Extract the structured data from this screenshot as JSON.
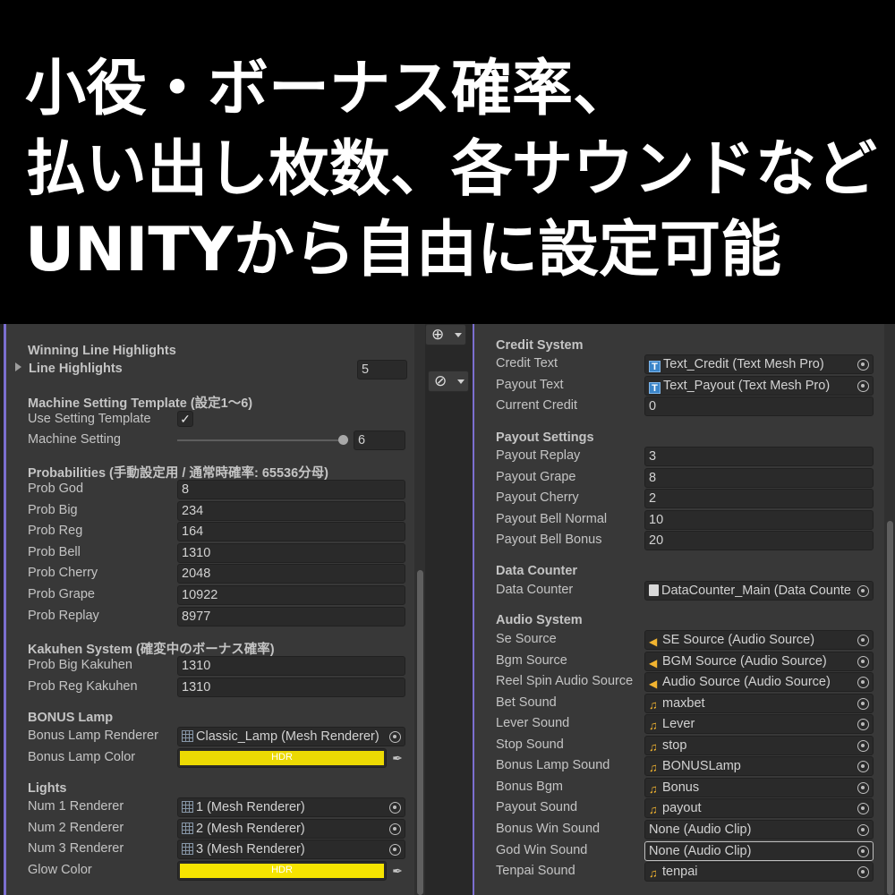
{
  "banner": {
    "line1": "小役・ボーナス確率、",
    "line2": "払い出し枚数、各サウンドなど",
    "line3": "UNITYから自由に設定可能"
  },
  "colors": {
    "lamp_color": "#ecda03",
    "glow_color": "#f6e400",
    "accent": "#7b6fd0"
  },
  "left": {
    "winning_header": "Winning Line Highlights",
    "line_highlights": {
      "label": "Line Highlights",
      "value": "5"
    },
    "machine_header": "Machine Setting Template (設定1～6)",
    "use_setting_template": {
      "label": "Use Setting Template",
      "checked": "✓"
    },
    "machine_setting": {
      "label": "Machine Setting",
      "value": "6"
    },
    "prob_header": "Probabilities (手動設定用 / 通常時確率: 65536分母)",
    "probs": [
      {
        "label": "Prob God",
        "value": "8"
      },
      {
        "label": "Prob Big",
        "value": "234"
      },
      {
        "label": "Prob Reg",
        "value": "164"
      },
      {
        "label": "Prob Bell",
        "value": "1310"
      },
      {
        "label": "Prob Cherry",
        "value": "2048"
      },
      {
        "label": "Prob Grape",
        "value": "10922"
      },
      {
        "label": "Prob Replay",
        "value": "8977"
      }
    ],
    "kakuhen_header": "Kakuhen System (確変中のボーナス確率)",
    "kakuhen": [
      {
        "label": "Prob Big Kakuhen",
        "value": "1310"
      },
      {
        "label": "Prob Reg Kakuhen",
        "value": "1310"
      }
    ],
    "bonus_header": "BONUS Lamp",
    "bonus_lamp_renderer": {
      "label": "Bonus Lamp Renderer",
      "value": "Classic_Lamp (Mesh Renderer)",
      "icon": "mesh-icon"
    },
    "bonus_lamp_color": {
      "label": "Bonus Lamp Color",
      "hdr": "HDR"
    },
    "lights_header": "Lights",
    "lights": [
      {
        "label": "Num 1 Renderer",
        "value": "1 (Mesh Renderer)"
      },
      {
        "label": "Num 2 Renderer",
        "value": "2 (Mesh Renderer)"
      },
      {
        "label": "Num 3 Renderer",
        "value": "3 (Mesh Renderer)"
      }
    ],
    "glow_color": {
      "label": "Glow Color",
      "hdr": "HDR"
    }
  },
  "right": {
    "credit_header": "Credit System",
    "credit_text": {
      "label": "Credit Text",
      "value": "Text_Credit (Text Mesh Pro)"
    },
    "payout_text": {
      "label": "Payout Text",
      "value": "Text_Payout (Text Mesh Pro)"
    },
    "current_credit": {
      "label": "Current Credit",
      "value": "0"
    },
    "payout_header": "Payout Settings",
    "payouts": [
      {
        "label": "Payout Replay",
        "value": "3"
      },
      {
        "label": "Payout Grape",
        "value": "8"
      },
      {
        "label": "Payout Cherry",
        "value": "2"
      },
      {
        "label": "Payout Bell Normal",
        "value": "10"
      },
      {
        "label": "Payout Bell Bonus",
        "value": "20"
      }
    ],
    "data_header": "Data Counter",
    "data_counter": {
      "label": "Data Counter",
      "value": "DataCounter_Main (Data Counte"
    },
    "audio_header": "Audio System",
    "audio_sources": [
      {
        "label": "Se Source",
        "value": "SE Source (Audio Source)"
      },
      {
        "label": "Bgm Source",
        "value": "BGM Source (Audio Source)"
      },
      {
        "label": "Reel Spin Audio Source",
        "value": "Audio Source (Audio Source)"
      }
    ],
    "sounds": [
      {
        "label": "Bet Sound",
        "value": "maxbet",
        "clip": true
      },
      {
        "label": "Lever Sound",
        "value": "Lever",
        "clip": true
      },
      {
        "label": "Stop Sound",
        "value": "stop",
        "clip": true
      },
      {
        "label": "Bonus Lamp Sound",
        "value": "BONUSLamp",
        "clip": true
      },
      {
        "label": "Bonus Bgm",
        "value": "Bonus",
        "clip": true
      },
      {
        "label": "Payout Sound",
        "value": "payout",
        "clip": true
      },
      {
        "label": "Bonus Win Sound",
        "value": "None (Audio Clip)",
        "clip": false
      },
      {
        "label": "God Win Sound",
        "value": "None (Audio Clip)",
        "clip": false
      },
      {
        "label": "Tenpai Sound",
        "value": "tenpai",
        "clip": true
      }
    ]
  }
}
